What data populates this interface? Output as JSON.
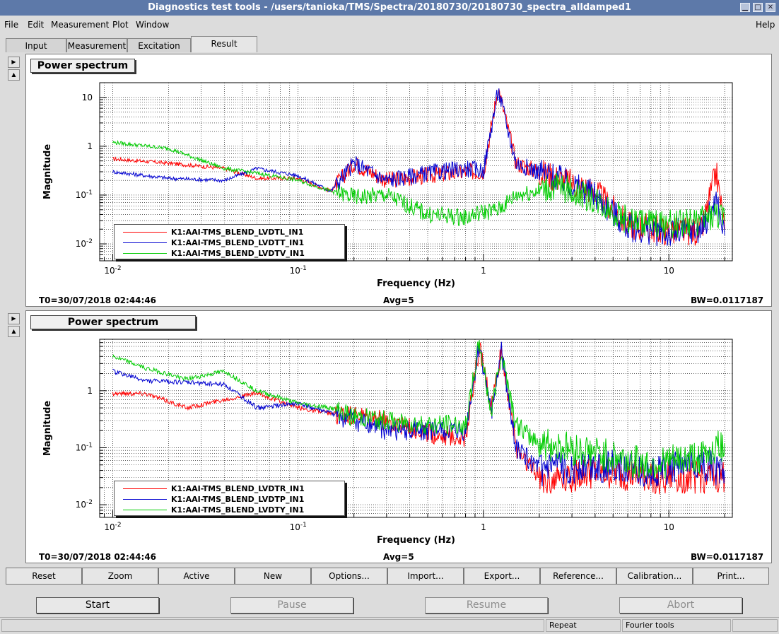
{
  "window": {
    "title": "Diagnostics test tools - /users/tanioka/TMS/Spectra/20180730/20180730_spectra_alldamped1"
  },
  "menu": {
    "file": "File",
    "edit": "Edit",
    "measurement": "Measurement",
    "plot": "Plot",
    "window": "Window",
    "help": "Help"
  },
  "tabs": [
    "Input",
    "Measurement",
    "Excitation",
    "Result"
  ],
  "active_tab": "Result",
  "colors": {
    "red": "#ff0000",
    "blue": "#0000d0",
    "green": "#00cc00",
    "title_bar": "#5d79a9"
  },
  "plots": [
    {
      "title": "Power spectrum",
      "ylabel": "Magnitude",
      "xlabel": "Frequency (Hz)",
      "t0": "T0=30/07/2018 02:44:46",
      "avg": "Avg=5",
      "bw": "BW=0.0117187",
      "legend": [
        "K1:AAI-TMS_BLEND_LVDTL_IN1",
        "K1:AAI-TMS_BLEND_LVDTT_IN1",
        "K1:AAI-TMS_BLEND_LVDTV_IN1"
      ]
    },
    {
      "title": "Power spectrum",
      "ylabel": "Magnitude",
      "xlabel": "Frequency (Hz)",
      "t0": "T0=30/07/2018 02:44:46",
      "avg": "Avg=5",
      "bw": "BW=0.0117187",
      "legend": [
        "K1:AAI-TMS_BLEND_LVDTR_IN1",
        "K1:AAI-TMS_BLEND_LVDTP_IN1",
        "K1:AAI-TMS_BLEND_LVDTY_IN1"
      ]
    }
  ],
  "chart_data": [
    {
      "type": "line",
      "title": "Power spectrum",
      "xlabel": "Frequency (Hz)",
      "ylabel": "Magnitude",
      "x_scale": "log",
      "y_scale": "log",
      "xlim": [
        0.0085,
        22
      ],
      "ylim": [
        0.0045,
        20
      ],
      "x_ticks": [
        "10^-2",
        "10^-1",
        "1",
        "10"
      ],
      "y_ticks": [
        "10^-2",
        "10^-1",
        "1",
        "10"
      ],
      "grid": true,
      "legend_position": "bottom-left",
      "series": [
        {
          "name": "K1:AAI-TMS_BLEND_LVDTL_IN1",
          "color": "red",
          "x": [
            0.01,
            0.02,
            0.04,
            0.06,
            0.1,
            0.15,
            0.2,
            0.3,
            0.5,
            0.8,
            1.0,
            1.2,
            1.5,
            2.5,
            4.0,
            6.0,
            10,
            15,
            18,
            20
          ],
          "y": [
            0.55,
            0.45,
            0.35,
            0.22,
            0.22,
            0.12,
            0.45,
            0.2,
            0.25,
            0.3,
            0.3,
            16,
            0.45,
            0.22,
            0.12,
            0.025,
            0.018,
            0.018,
            0.3,
            0.02
          ]
        },
        {
          "name": "K1:AAI-TMS_BLEND_LVDTT_IN1",
          "color": "blue",
          "x": [
            0.01,
            0.02,
            0.04,
            0.06,
            0.1,
            0.15,
            0.2,
            0.3,
            0.5,
            0.8,
            1.0,
            1.2,
            1.5,
            2.5,
            4.0,
            6.0,
            10,
            15,
            18,
            20
          ],
          "y": [
            0.3,
            0.22,
            0.2,
            0.35,
            0.25,
            0.12,
            0.45,
            0.2,
            0.28,
            0.35,
            0.32,
            14,
            0.45,
            0.22,
            0.1,
            0.022,
            0.016,
            0.02,
            0.08,
            0.015
          ]
        },
        {
          "name": "K1:AAI-TMS_BLEND_LVDTV_IN1",
          "color": "green",
          "x": [
            0.01,
            0.02,
            0.04,
            0.06,
            0.1,
            0.15,
            0.2,
            0.3,
            0.5,
            0.8,
            1.0,
            1.2,
            1.5,
            2.5,
            4.0,
            6.0,
            10,
            15,
            18,
            20
          ],
          "y": [
            1.2,
            0.9,
            0.35,
            0.28,
            0.2,
            0.12,
            0.09,
            0.1,
            0.04,
            0.035,
            0.045,
            0.05,
            0.1,
            0.15,
            0.08,
            0.03,
            0.025,
            0.03,
            0.04,
            0.03
          ]
        }
      ]
    },
    {
      "type": "line",
      "title": "Power spectrum",
      "xlabel": "Frequency (Hz)",
      "ylabel": "Magnitude",
      "x_scale": "log",
      "y_scale": "log",
      "xlim": [
        0.0085,
        22
      ],
      "ylim": [
        0.006,
        8
      ],
      "x_ticks": [
        "10^-2",
        "10^-1",
        "1",
        "10"
      ],
      "y_ticks": [
        "10^-2",
        "10^-1",
        "1"
      ],
      "grid": true,
      "legend_position": "bottom-left",
      "series": [
        {
          "name": "K1:AAI-TMS_BLEND_LVDTR_IN1",
          "color": "red",
          "x": [
            0.01,
            0.015,
            0.025,
            0.04,
            0.06,
            0.1,
            0.15,
            0.2,
            0.3,
            0.5,
            0.8,
            0.95,
            1.1,
            1.25,
            1.5,
            2.0,
            4.0,
            8.0,
            15,
            20
          ],
          "y": [
            0.9,
            0.9,
            0.5,
            0.7,
            0.9,
            0.5,
            0.4,
            0.35,
            0.3,
            0.18,
            0.15,
            6,
            0.5,
            5,
            0.1,
            0.03,
            0.035,
            0.03,
            0.03,
            0.03
          ]
        },
        {
          "name": "K1:AAI-TMS_BLEND_LVDTP_IN1",
          "color": "blue",
          "x": [
            0.01,
            0.015,
            0.025,
            0.04,
            0.06,
            0.1,
            0.15,
            0.2,
            0.3,
            0.5,
            0.8,
            0.95,
            1.1,
            1.25,
            1.5,
            2.0,
            4.0,
            8.0,
            15,
            20
          ],
          "y": [
            2.2,
            1.5,
            1.4,
            1.3,
            0.5,
            0.6,
            0.4,
            0.3,
            0.2,
            0.2,
            0.18,
            6,
            0.4,
            5,
            0.1,
            0.04,
            0.05,
            0.04,
            0.05,
            0.04
          ]
        },
        {
          "name": "K1:AAI-TMS_BLEND_LVDTY_IN1",
          "color": "green",
          "x": [
            0.01,
            0.015,
            0.025,
            0.04,
            0.06,
            0.1,
            0.15,
            0.2,
            0.3,
            0.5,
            0.8,
            0.95,
            1.1,
            1.25,
            1.5,
            2.0,
            4.0,
            8.0,
            15,
            20
          ],
          "y": [
            4,
            2.5,
            1.6,
            2.2,
            1.0,
            0.6,
            0.5,
            0.35,
            0.3,
            0.25,
            0.25,
            7,
            0.4,
            5,
            0.25,
            0.12,
            0.08,
            0.05,
            0.07,
            0.12
          ]
        }
      ]
    }
  ],
  "buttons": [
    "Reset",
    "Zoom",
    "Active",
    "New",
    "Options...",
    "Import...",
    "Export...",
    "Reference...",
    "Calibration...",
    "Print..."
  ],
  "controls": {
    "start": "Start",
    "pause": "Pause",
    "resume": "Resume",
    "abort": "Abort"
  },
  "status": {
    "repeat": "Repeat",
    "fourier": "Fourier tools"
  }
}
